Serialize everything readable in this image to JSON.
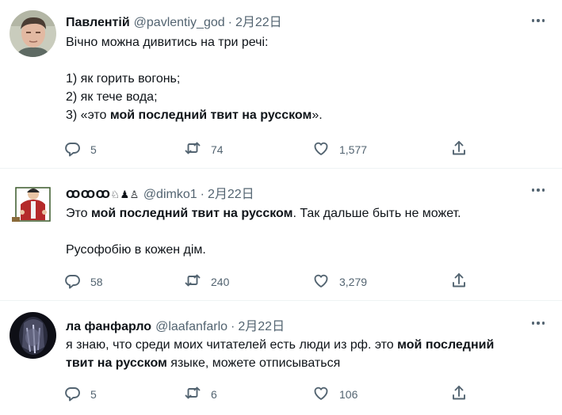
{
  "tweets": [
    {
      "name": "Павлентій",
      "handle": "@pavlentiy_god",
      "date": "2月22日",
      "lines": [
        [
          "Вічно можна дивитись на три речі:"
        ],
        [],
        [
          "1) як горить вогонь;"
        ],
        [
          "2) як тече вода;"
        ],
        [
          "3) «это ",
          {
            "b": "мой последний твит на русском"
          },
          "»."
        ]
      ],
      "counts": {
        "replies": "5",
        "retweets": "74",
        "likes": "1,577"
      }
    },
    {
      "name": "ꝎꝎꝎ♘♟♙",
      "handle": "@dimko1",
      "date": "2月22日",
      "lines": [
        [
          "Это ",
          {
            "b": "мой последний твит на русском"
          },
          ". Так дальше быть не может."
        ],
        [],
        [
          "Русофобію в кожен дім."
        ]
      ],
      "counts": {
        "replies": "58",
        "retweets": "240",
        "likes": "3,279"
      }
    },
    {
      "name": "ла фанфарло",
      "handle": "@laafanfarlo",
      "date": "2月22日",
      "lines": [
        [
          "я знаю, что среди моих читателей есть люди из рф. это ",
          {
            "b": "мой последний"
          }
        ],
        [
          {
            "b": "твит на русском"
          },
          " языке, можете отписываться"
        ]
      ],
      "counts": {
        "replies": "5",
        "retweets": "6",
        "likes": "106"
      }
    }
  ],
  "icons": {
    "reply": "reply-icon",
    "retweet": "retweet-icon",
    "like": "like-icon",
    "share": "share-icon",
    "more": "more-icon"
  },
  "colors": {
    "text": "#0f1419",
    "secondary": "#536471",
    "divider": "#eff3f4"
  }
}
